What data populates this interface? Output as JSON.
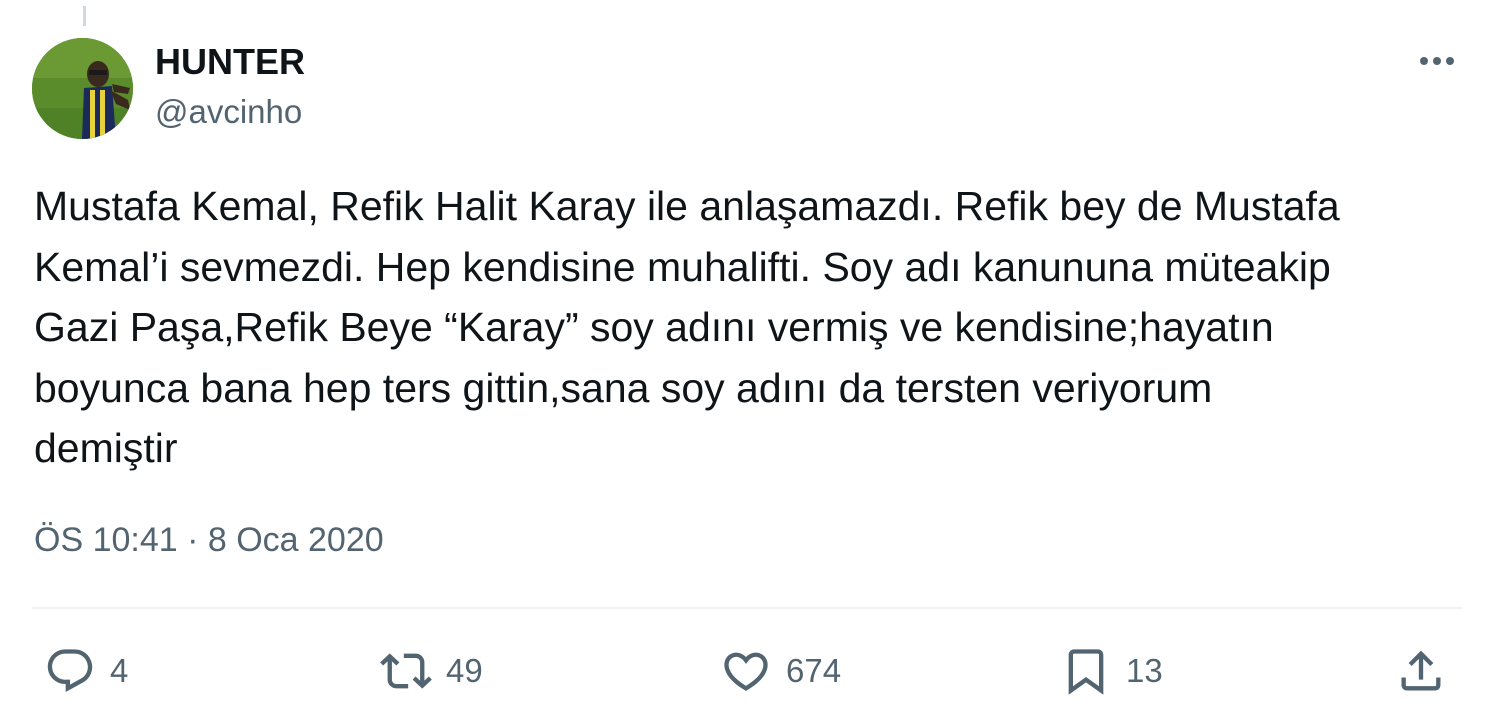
{
  "tweet": {
    "author_name": "HUNTER",
    "author_handle": "@avcinho",
    "text": "Mustafa Kemal, Refik Halit Karay ile anlaşamazdı. Refik bey de Mustafa\nKemal’i sevmezdi. Hep kendisine muhalifti. Soy adı kanununa müteakip\nGazi Paşa,Refik Beye “Karay” soy adını vermiş ve kendisine;hayatın\nboyunca bana hep ters gittin,sana soy adını da tersten veriyorum\ndemiştir",
    "timestamp": "ÖS 10:41 · 8 Oca 2020"
  },
  "actions": {
    "reply": {
      "icon": "reply-icon",
      "count": "4"
    },
    "retweet": {
      "icon": "retweet-icon",
      "count": "49"
    },
    "like": {
      "icon": "heart-icon",
      "count": "674"
    },
    "bookmark": {
      "icon": "bookmark-icon",
      "count": "13"
    },
    "share": {
      "icon": "share-icon"
    }
  },
  "colors": {
    "text_primary": "#0f1419",
    "text_secondary": "#536471",
    "divider": "#eff3f4"
  }
}
